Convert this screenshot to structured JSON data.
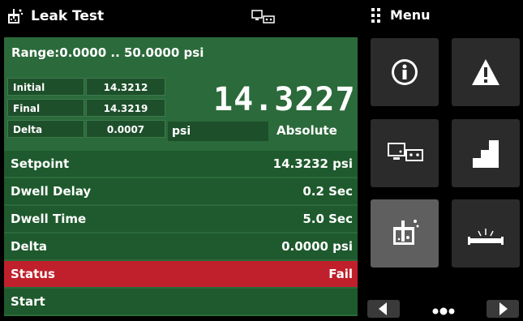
{
  "header": {
    "title": "Leak Test",
    "menu_label": "Menu"
  },
  "panel": {
    "range": "Range:0.0000 .. 50.0000 psi",
    "readings": [
      {
        "label": "Initial",
        "value": "14.3212"
      },
      {
        "label": "Final",
        "value": "14.3219"
      },
      {
        "label": "Delta",
        "value": "0.0007"
      }
    ],
    "big_value": "14.3227",
    "unit": "psi",
    "mode": "Absolute"
  },
  "list": [
    {
      "label": "Setpoint",
      "value": "14.3232 psi"
    },
    {
      "label": "Dwell Delay",
      "value": "0.2 Sec"
    },
    {
      "label": "Dwell Time",
      "value": "5.0 Sec"
    },
    {
      "label": "Delta",
      "value": "0.0000 psi"
    },
    {
      "label": "Status",
      "value": "Fail"
    },
    {
      "label": "Start",
      "value": ""
    }
  ],
  "menu_tiles": [
    {
      "icon": "info-icon"
    },
    {
      "icon": "warning-icon"
    },
    {
      "icon": "remote-connection-icon"
    },
    {
      "icon": "step-icon"
    },
    {
      "icon": "leak-test-icon",
      "selected": true
    },
    {
      "icon": "burst-test-icon"
    }
  ],
  "colors": {
    "panel_green": "#2b6a3a",
    "row_green": "#1e5a2d",
    "fail_red": "#c0202b",
    "tile_dark": "#2b2b2b",
    "tile_selected": "#5f5f5f"
  }
}
